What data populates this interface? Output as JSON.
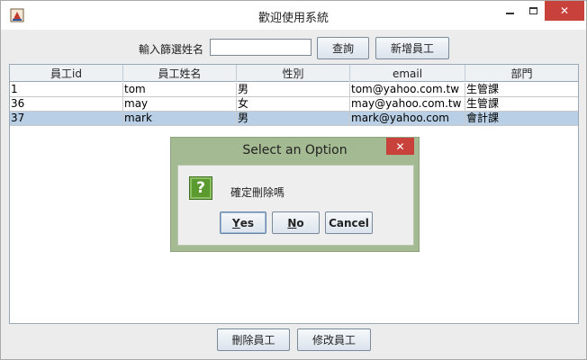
{
  "window": {
    "title": "歡迎使用系統"
  },
  "search": {
    "label": "輸入篩選姓名",
    "value": "",
    "query_button": "查詢",
    "add_button": "新增員工"
  },
  "table": {
    "columns": [
      "員工id",
      "員工姓名",
      "性別",
      "email",
      "部門"
    ],
    "rows": [
      {
        "id": "1",
        "name": "tom",
        "gender": "男",
        "email": "tom@yahoo.com.tw",
        "dept": "生管課"
      },
      {
        "id": "36",
        "name": "may",
        "gender": "女",
        "email": "may@yahoo.com.tw",
        "dept": "生管課"
      },
      {
        "id": "37",
        "name": "mark",
        "gender": "男",
        "email": "mark@yahoo.com",
        "dept": "會計課"
      }
    ],
    "selected_row": 2
  },
  "actions": {
    "delete_button": "刪除員工",
    "edit_button": "修改員工"
  },
  "dialog": {
    "title": "Select an Option",
    "message": "確定刪除嗎",
    "icon": "question-icon",
    "icon_glyph": "?",
    "yes_mnemonic": "Y",
    "yes_rest": "es",
    "no_mnemonic": "N",
    "no_rest": "o",
    "cancel": "Cancel"
  },
  "colors": {
    "selection": "#b8cfe5",
    "dialog_frame": "#a4ba92",
    "close_button": "#c8413b"
  }
}
